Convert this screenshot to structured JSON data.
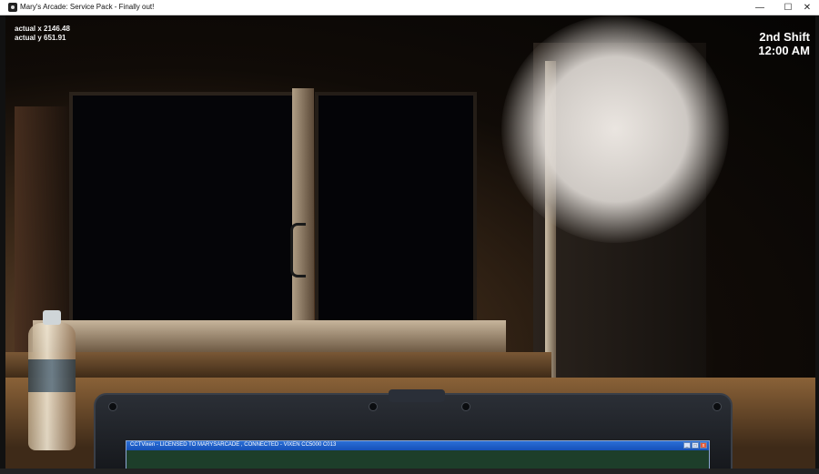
{
  "window": {
    "title": "Mary's Arcade: Service Pack - Finally out!",
    "buttons": {
      "minimize": "—",
      "maximize": "☐",
      "close": "✕"
    }
  },
  "hud": {
    "actual_x": "actual x 2146.48",
    "actual_y": "actual y 651.91",
    "shift": "2nd Shift",
    "time": "12:00 AM"
  },
  "cctv": {
    "title": "CCTVixen - LICENSED TO MARYSARCADE , CONNECTED - VIXEN CC5000 C013",
    "buttons": {
      "minimize": "_",
      "maximize": "□",
      "close": "x"
    }
  }
}
